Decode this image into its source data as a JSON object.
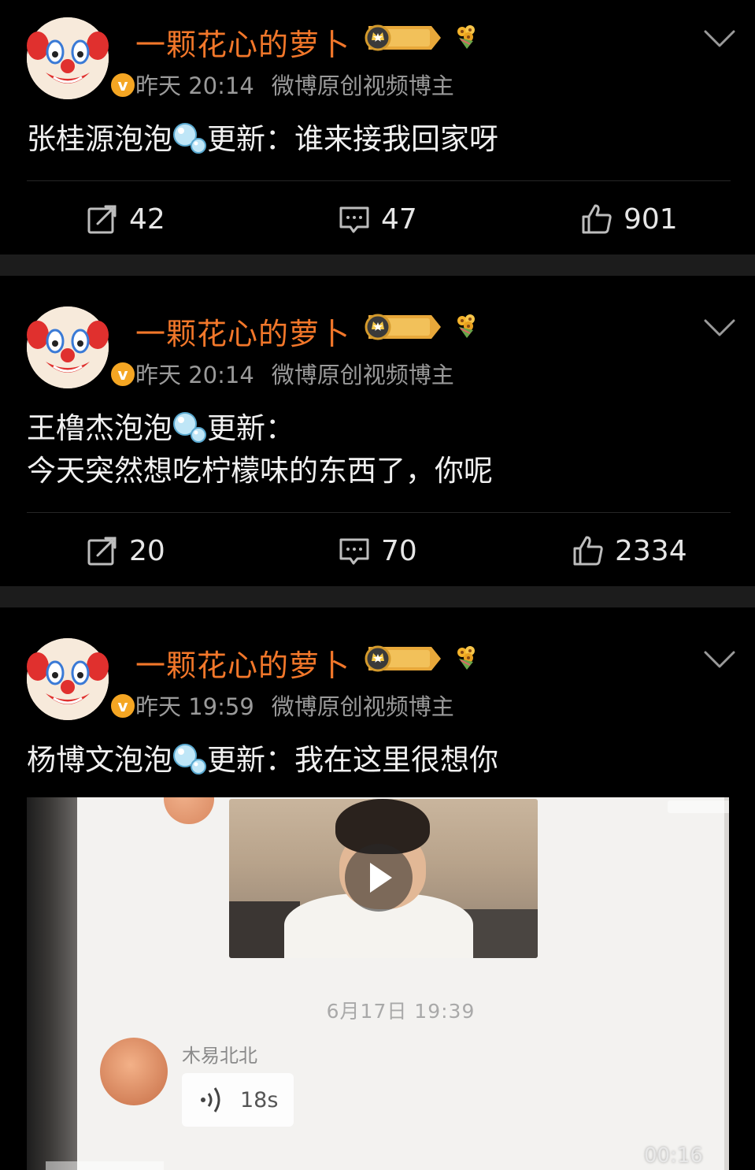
{
  "posts": [
    {
      "username": "一颗花心的萝卜",
      "time": "昨天 20:14",
      "tag": "微博原创视频博主",
      "content_lines": [
        "张桂源泡泡",
        "更新：谁来接我回家呀"
      ],
      "repost": "42",
      "comment": "47",
      "like": "901"
    },
    {
      "username": "一颗花心的萝卜",
      "time": "昨天 20:14",
      "tag": "微博原创视频博主",
      "content_lines": [
        "王橹杰泡泡",
        "更新：",
        "今天突然想吃柠檬味的东西了，你呢"
      ],
      "repost": "20",
      "comment": "70",
      "like": "2334"
    },
    {
      "username": "一颗花心的萝卜",
      "time": "昨天 19:59",
      "tag": "微博原创视频博主",
      "content_lines": [
        "杨博文泡泡",
        "更新：我在这里很想你"
      ],
      "media": {
        "chat_date": "6月17日 19:39",
        "chat_sender": "木易北北",
        "voice_duration": "18s",
        "video_time": "00:16"
      }
    }
  ],
  "badges": {
    "level": "Ⅲ",
    "verified": "v"
  },
  "icons": [
    "clown-avatar",
    "verified-badge-icon",
    "crown-level-badge-icon",
    "flower-icon",
    "chevron-down-icon",
    "bubble-icon",
    "repost-icon",
    "comment-icon",
    "like-icon",
    "play-icon",
    "voice-icon"
  ],
  "colors": {
    "username": "#f2772a",
    "meta": "#9a9a9a",
    "background": "#000000",
    "separator": "#1c1c1c"
  }
}
